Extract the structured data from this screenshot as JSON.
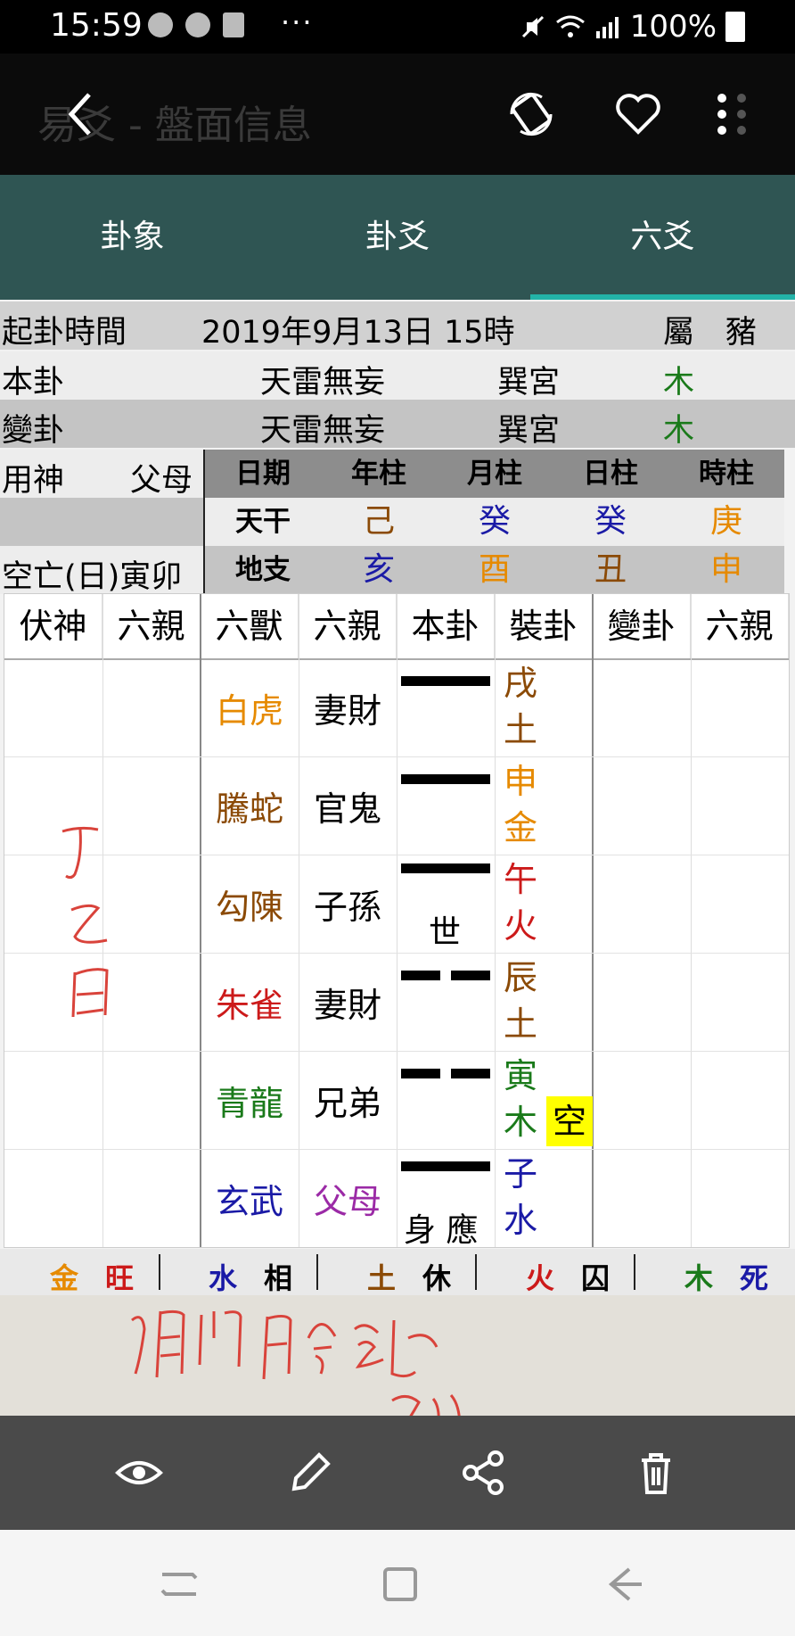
{
  "status_bar": {
    "time": "15:59",
    "more": "···",
    "battery": "100%"
  },
  "app_bar": {
    "title": "易爻 - 盤面信息"
  },
  "tabs": [
    {
      "label": "卦象"
    },
    {
      "label": "卦爻"
    },
    {
      "label": "六爻"
    }
  ],
  "info": {
    "time_label": "起卦時間",
    "time_value": "2019年9月13日 15時",
    "zodiac": "屬　豬",
    "ben_gua_label": "本卦",
    "ben_gua_name": "天雷無妄",
    "ben_gua_palace": "巽宮",
    "ben_gua_element": "木",
    "bian_gua_label": "變卦",
    "bian_gua_name": "天雷無妄",
    "bian_gua_palace": "巽宮",
    "bian_gua_element": "木",
    "yongshen_label": "用神",
    "yongshen_value": "父母",
    "kongwang": "空亡(日)寅卯"
  },
  "pillars": {
    "headers": [
      "日期",
      "年柱",
      "月柱",
      "日柱",
      "時柱"
    ],
    "gan": [
      "天干",
      "己",
      "癸",
      "癸",
      "庚"
    ],
    "zhi": [
      "地支",
      "亥",
      "酉",
      "丑",
      "申"
    ]
  },
  "table": {
    "headers": [
      "伏神",
      "六親",
      "六獸",
      "六親",
      "本卦",
      "裝卦",
      "變卦",
      "六親"
    ],
    "rows": [
      {
        "beast": "白虎",
        "kin": "妻財",
        "zhi": "戌",
        "wx": "土"
      },
      {
        "beast": "騰蛇",
        "kin": "官鬼",
        "zhi": "申",
        "wx": "金"
      },
      {
        "beast": "勾陳",
        "kin": "子孫",
        "zhi": "午",
        "wx": "火",
        "mark": "世"
      },
      {
        "beast": "朱雀",
        "kin": "妻財",
        "zhi": "辰",
        "wx": "土"
      },
      {
        "beast": "青龍",
        "kin": "兄弟",
        "zhi": "寅",
        "wx": "木",
        "kong": "空"
      },
      {
        "beast": "玄武",
        "kin": "父母",
        "zhi": "子",
        "wx": "水",
        "mark": "身 應"
      }
    ]
  },
  "wuxing_state": [
    {
      "el": "金",
      "state": "旺"
    },
    {
      "el": "水",
      "state": "相"
    },
    {
      "el": "土",
      "state": "休"
    },
    {
      "el": "火",
      "state": "囚"
    },
    {
      "el": "木",
      "state": "死"
    }
  ],
  "colors": {
    "gold": "#e68a00",
    "blue": "#1a1aa6",
    "brown": "#8b4a06",
    "red": "#cc1a1a",
    "green": "#1a7a1a",
    "purple": "#9b2aa6",
    "teal": "#2f5553"
  }
}
